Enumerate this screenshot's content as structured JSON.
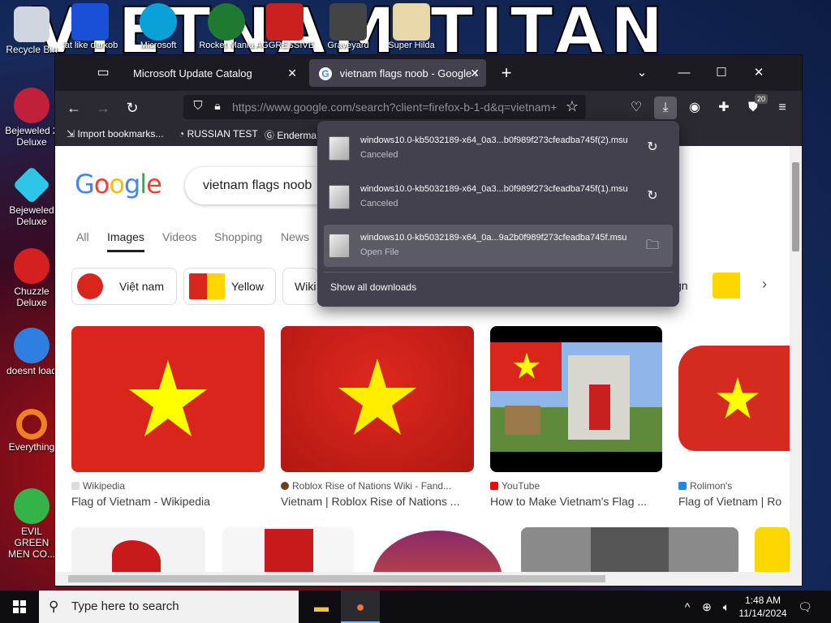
{
  "desktop": {
    "wallpaper_text": "VIETNAM TITAN",
    "top_icons": [
      {
        "label": "fat like darkob",
        "color": "#1a4fd8"
      },
      {
        "label": "Microsoft",
        "color": "#0aa1d8"
      },
      {
        "label": "Rocket Mania",
        "color": "#1e7a30"
      },
      {
        "label": "AGGRESSIVE",
        "color": "#cc1f1f"
      },
      {
        "label": "Graveyard",
        "color": "#444"
      },
      {
        "label": "Super Hilda",
        "color": "#e8d7a8"
      }
    ],
    "side_icons": [
      {
        "label": "Recycle Bin",
        "color": "#cfd6df"
      },
      {
        "label": "Bejeweled 2 Deluxe",
        "color": "#c0203a"
      },
      {
        "label": "Bejeweled Deluxe",
        "color": "#2ec6e6"
      },
      {
        "label": "Chuzzle Deluxe",
        "color": "#d42020"
      },
      {
        "label": "doesnt load",
        "color": "#2f7fe0"
      },
      {
        "label": "Everything",
        "color": "#f08020"
      },
      {
        "label": "EVIL GREEN MEN CO...",
        "color": "#34b34a"
      }
    ]
  },
  "browser": {
    "tabs": [
      {
        "title": "Microsoft Update Catalog"
      },
      {
        "title": "vietnam flags noob - Google Search"
      }
    ],
    "url": "https://www.google.com/search?client=firefox-b-1-d&q=vietnam+",
    "extensions_badge": "20",
    "bookmarks": [
      "Import bookmarks...",
      "RUSSIAN TEST",
      "Enderma"
    ],
    "downloads": {
      "items": [
        {
          "filename": "windows10.0-kb5032189-x64_0a3...b0f989f273cfeadba745f(2).msu",
          "status": "Canceled",
          "action_icon": "retry-icon"
        },
        {
          "filename": "windows10.0-kb5032189-x64_0a3...b0f989f273cfeadba745f(1).msu",
          "status": "Canceled",
          "action_icon": "retry-icon"
        },
        {
          "filename": "windows10.0-kb5032189-x64_0a...9a2b0f989f273cfeadba745f.msu",
          "status": "Open File",
          "action_icon": "folder-icon"
        }
      ],
      "show_all": "Show all downloads"
    }
  },
  "google": {
    "query": "vietnam flags noob",
    "tabs": [
      "All",
      "Images",
      "Videos",
      "Shopping",
      "News"
    ],
    "active_tab": "Images",
    "chips": [
      "Việt nam",
      "Yellow",
      "Wiki",
      "gn"
    ],
    "results": [
      {
        "source": "Wikipedia",
        "title": "Flag of Vietnam - Wikipedia",
        "source_color": "#202124"
      },
      {
        "source": "Roblox Rise of Nations Wiki - Fand...",
        "title": "Vietnam | Roblox Rise of Nations ...",
        "source_color": "#6b3f1f"
      },
      {
        "source": "YouTube",
        "title": "How to Make Vietnam's Flag ...",
        "source_color": "#ff0000"
      },
      {
        "source": "Rolimon's",
        "title": "Flag of Vietnam | Ro",
        "source_color": "#1e88e5"
      }
    ]
  },
  "taskbar": {
    "search_placeholder": "Type here to search",
    "time": "1:48 AM",
    "date": "11/14/2024"
  },
  "colors": {
    "flag_red": "#da251d",
    "flag_yellow": "#ffff00",
    "firefox_dark": "#2b2a33",
    "panel": "#42414d"
  }
}
